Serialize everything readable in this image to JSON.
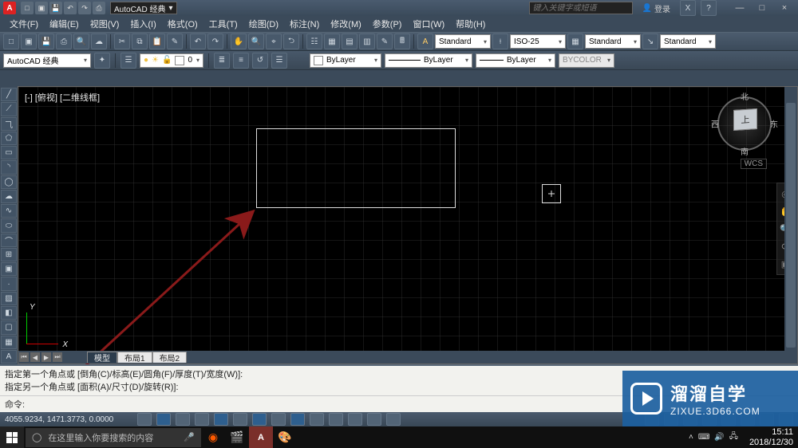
{
  "titlebar": {
    "workspace": "AutoCAD 经典",
    "search_placeholder": "键入关键字或短语",
    "login": "登录",
    "min": "—",
    "max": "□",
    "close": "×"
  },
  "menu": {
    "items": [
      "文件(F)",
      "编辑(E)",
      "视图(V)",
      "插入(I)",
      "格式(O)",
      "工具(T)",
      "绘图(D)",
      "标注(N)",
      "修改(M)",
      "参数(P)",
      "窗口(W)",
      "帮助(H)"
    ]
  },
  "toolbar1": {
    "style1": "Standard",
    "style2": "ISO-25",
    "style3": "Standard",
    "style4": "Standard"
  },
  "row2": {
    "workspace": "AutoCAD 经典",
    "layer": "0",
    "color_by": "ByLayer",
    "lt_by": "ByLayer",
    "lw_by": "ByLayer",
    "plotstyle": "BYCOLOR"
  },
  "viewport": {
    "label": "[-] [俯视] [二维线框]",
    "viewcube_top": "上",
    "viewcube_n": "北",
    "viewcube_s": "南",
    "viewcube_e": "东",
    "viewcube_w": "西",
    "wcs": "WCS",
    "ucs_x": "X",
    "ucs_y": "Y"
  },
  "tabs": {
    "model": "模型",
    "layout1": "布局1",
    "layout2": "布局2"
  },
  "command": {
    "hist1": "指定第一个角点或 [倒角(C)/标高(E)/圆角(F)/厚度(T)/宽度(W)]:",
    "hist2": "指定另一个角点或 [面积(A)/尺寸(D)/旋转(R)]:",
    "prompt_label": "命令:",
    "prompt_value": ""
  },
  "status": {
    "coords": "4055.9234, 1471.3773, 0.0000"
  },
  "taskbar": {
    "search_placeholder": "在这里输入你要搜索的内容",
    "time": "15:11",
    "date": "2018/12/30"
  },
  "watermark": {
    "title": "溜溜自学",
    "url": "ZIXUE.3D66.COM"
  }
}
